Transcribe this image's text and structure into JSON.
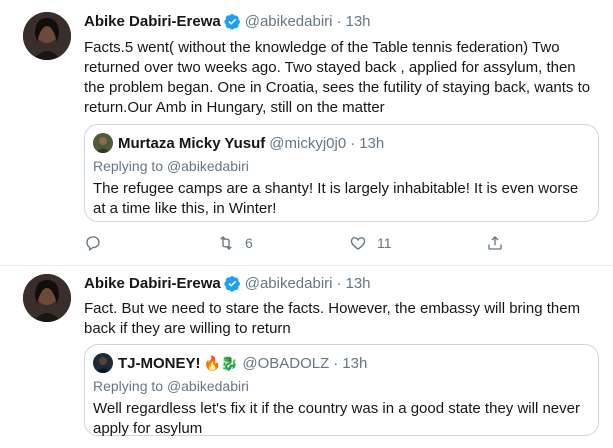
{
  "tweets": [
    {
      "author_name": "Abike Dabiri-Erewa",
      "author_handle": "@abikedabiri",
      "separator": "·",
      "time": "13h",
      "text": "Facts.5 went( without the knowledge of the Table tennis federation) Two returned over two weeks ago. Two stayed back , applied for assylum, then the problem began. One in Croatia, sees the futility of staying back, wants to return.Our Amb in Hungary, still on the matter",
      "quote": {
        "author_name": "Murtaza Micky Yusuf",
        "author_handle": "@mickyj0j0",
        "separator": "·",
        "time": "13h",
        "replying_prefix": "Replying to",
        "replying_to": "@abikedabiri",
        "text": "The refugee camps are a shanty! It is largely inhabitable! It is even worse at a time like this, in Winter!"
      },
      "actions": {
        "reply_icon": "reply-icon",
        "retweet_icon": "retweet-icon",
        "retweet_count": "6",
        "like_icon": "heart-icon",
        "like_count": "11",
        "share_icon": "share-icon"
      }
    },
    {
      "author_name": "Abike Dabiri-Erewa",
      "author_handle": "@abikedabiri",
      "separator": "·",
      "time": "13h",
      "text": "Fact. But we need to stare the facts. However, the embassy will bring them back if they are willing to return",
      "quote": {
        "author_name": "TJ-MONEY!",
        "author_emojis": "🔥🐉",
        "author_handle": "@OBADOLZ",
        "separator": "·",
        "time": "13h",
        "replying_prefix": "Replying to",
        "replying_to": "@abikedabiri",
        "text": "Well regardless let's fix it if the country was in a good state they will never apply for asylum"
      }
    }
  ],
  "colors": {
    "text_primary": "#14171a",
    "text_secondary": "#657786",
    "verified_blue": "#1da1f2",
    "border": "#e6ecf0",
    "quote_border": "#ccd6dd"
  }
}
